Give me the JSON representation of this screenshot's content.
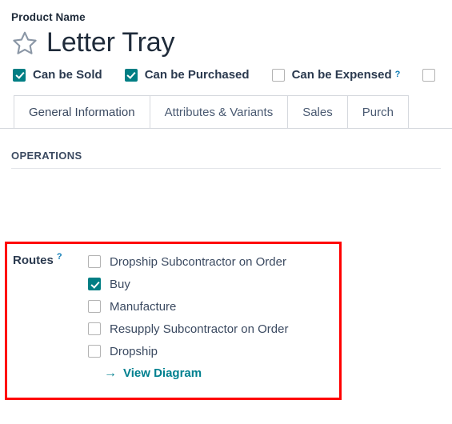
{
  "header": {
    "field_label": "Product Name",
    "favorite_icon": "star-outline-icon",
    "product_name": "Letter Tray"
  },
  "flags": [
    {
      "label": "Can be Sold",
      "checked": true,
      "help": ""
    },
    {
      "label": "Can be Purchased",
      "checked": true,
      "help": ""
    },
    {
      "label": "Can be Expensed",
      "checked": false,
      "help": "?"
    },
    {
      "label": "",
      "checked": false,
      "help": ""
    }
  ],
  "tabs": [
    {
      "label": "General Information",
      "active": true
    },
    {
      "label": "Attributes & Variants",
      "active": false
    },
    {
      "label": "Sales",
      "active": false
    },
    {
      "label": "Purch",
      "active": false
    }
  ],
  "operations": {
    "section_title": "OPERATIONS",
    "routes_label": "Routes",
    "routes_help": "?",
    "routes": [
      {
        "label": "Dropship Subcontractor on Order",
        "checked": false
      },
      {
        "label": "Buy",
        "checked": true
      },
      {
        "label": "Manufacture",
        "checked": false
      },
      {
        "label": "Resupply Subcontractor on Order",
        "checked": false
      },
      {
        "label": "Dropship",
        "checked": false
      }
    ],
    "view_diagram": {
      "icon": "arrow-right-icon",
      "arrow_glyph": "→",
      "label": "View Diagram"
    }
  },
  "colors": {
    "accent_teal": "#017e84",
    "link_teal": "#00808f",
    "highlight_red": "#ff0000",
    "text_dark": "#2b3a4f",
    "help_blue": "#0d7bb5"
  }
}
